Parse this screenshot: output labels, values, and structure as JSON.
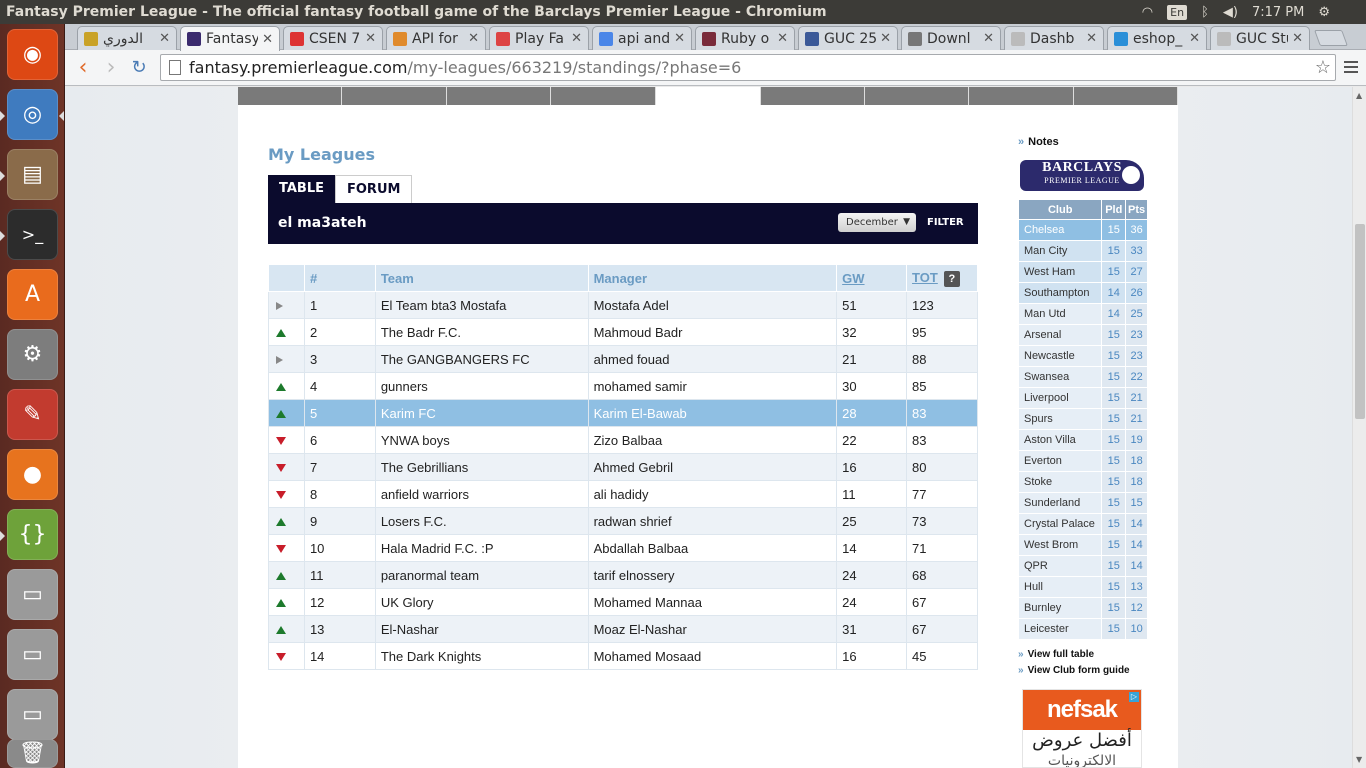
{
  "system": {
    "window_title": "Fantasy Premier League - The official fantasy football game of the Barclays Premier League - Chromium",
    "keyboard_layout": "En",
    "clock": "7:17 PM"
  },
  "launcher": {
    "items": [
      "ubuntu-dash",
      "chromium",
      "files",
      "terminal",
      "software-center",
      "system-settings",
      "document-viewer",
      "firefox",
      "brackets",
      "disk-1",
      "disk-2",
      "disk-3",
      "trash"
    ]
  },
  "browser": {
    "tabs": [
      {
        "label": "الدوري",
        "icon": "league-icon",
        "color": "#c9a227"
      },
      {
        "label": "Fantasy",
        "icon": "fpl-icon",
        "color": "#3b2b6e",
        "active": true
      },
      {
        "label": "CSEN 7",
        "icon": "csen-icon",
        "color": "#d33"
      },
      {
        "label": "API for",
        "icon": "api-icon",
        "color": "#e08a2b"
      },
      {
        "label": "Play Fa",
        "icon": "gmail-icon",
        "color": "#d44"
      },
      {
        "label": "api and",
        "icon": "google-icon",
        "color": "#4a86e8"
      },
      {
        "label": "Ruby o",
        "icon": "ruby-icon",
        "color": "#7a2b3a"
      },
      {
        "label": "GUC 25",
        "icon": "facebook-icon",
        "color": "#3b5998"
      },
      {
        "label": "Downl",
        "icon": "download-icon",
        "color": "#777"
      },
      {
        "label": "Dashb",
        "icon": "page-icon",
        "color": "#bbb"
      },
      {
        "label": "eshop_",
        "icon": "eshop-icon",
        "color": "#2a8fd8"
      },
      {
        "label": "GUC Stu",
        "icon": "page-icon",
        "color": "#bbb"
      }
    ],
    "url_host": "fantasy.premierleague.com",
    "url_path": "/my-leagues/663219/standings/?phase=6"
  },
  "page": {
    "heading": "My Leagues",
    "tabs": {
      "table": "TABLE",
      "forum": "FORUM"
    },
    "league_name": "el ma3ateh",
    "phase_select": "December",
    "filter_label": "FILTER",
    "columns": {
      "rank": "#",
      "team": "Team",
      "manager": "Manager",
      "gw": "GW",
      "tot": "TOT",
      "help": "?"
    },
    "rows": [
      {
        "move": "same",
        "rank": "1",
        "team": "El Team bta3 Mostafa",
        "manager": "Mostafa Adel",
        "gw": "51",
        "tot": "123"
      },
      {
        "move": "up",
        "rank": "2",
        "team": "The Badr F.C.",
        "manager": "Mahmoud Badr",
        "gw": "32",
        "tot": "95"
      },
      {
        "move": "same",
        "rank": "3",
        "team": "The GANGBANGERS FC",
        "manager": "ahmed fouad",
        "gw": "21",
        "tot": "88"
      },
      {
        "move": "up",
        "rank": "4",
        "team": "gunners",
        "manager": "mohamed samir",
        "gw": "30",
        "tot": "85"
      },
      {
        "move": "up",
        "rank": "5",
        "team": "Karim FC",
        "manager": "Karim El-Bawab",
        "gw": "28",
        "tot": "83",
        "highlight": true
      },
      {
        "move": "down",
        "rank": "6",
        "team": "YNWA boys",
        "manager": "Zizo Balbaa",
        "gw": "22",
        "tot": "83"
      },
      {
        "move": "down",
        "rank": "7",
        "team": "The Gebrillians",
        "manager": "Ahmed Gebril",
        "gw": "16",
        "tot": "80"
      },
      {
        "move": "down",
        "rank": "8",
        "team": "anfield warriors",
        "manager": "ali hadidy",
        "gw": "11",
        "tot": "77"
      },
      {
        "move": "up",
        "rank": "9",
        "team": "Losers F.C.",
        "manager": "radwan shrief",
        "gw": "25",
        "tot": "73"
      },
      {
        "move": "down",
        "rank": "10",
        "team": "Hala Madrid F.C. :P",
        "manager": "Abdallah Balbaa",
        "gw": "14",
        "tot": "71"
      },
      {
        "move": "up",
        "rank": "11",
        "team": "paranormal team",
        "manager": "tarif elnossery",
        "gw": "24",
        "tot": "68"
      },
      {
        "move": "up",
        "rank": "12",
        "team": "UK Glory",
        "manager": "Mohamed Mannaa",
        "gw": "24",
        "tot": "67"
      },
      {
        "move": "up",
        "rank": "13",
        "team": "El-Nashar",
        "manager": "Moaz El-Nashar",
        "gw": "31",
        "tot": "67"
      },
      {
        "move": "down",
        "rank": "14",
        "team": "The Dark Knights",
        "manager": "Mohamed Mosaad",
        "gw": "16",
        "tot": "45"
      }
    ]
  },
  "sidebar": {
    "notes": "Notes",
    "logo_line1": "BARCLAYS",
    "logo_line2": "PREMIER LEAGUE",
    "table_headers": {
      "club": "Club",
      "pld": "Pld",
      "pts": "Pts"
    },
    "clubs": [
      {
        "club": "Chelsea",
        "pld": "15",
        "pts": "36"
      },
      {
        "club": "Man City",
        "pld": "15",
        "pts": "33"
      },
      {
        "club": "West Ham",
        "pld": "15",
        "pts": "27"
      },
      {
        "club": "Southampton",
        "pld": "14",
        "pts": "26"
      },
      {
        "club": "Man Utd",
        "pld": "14",
        "pts": "25"
      },
      {
        "club": "Arsenal",
        "pld": "15",
        "pts": "23"
      },
      {
        "club": "Newcastle",
        "pld": "15",
        "pts": "23"
      },
      {
        "club": "Swansea",
        "pld": "15",
        "pts": "22"
      },
      {
        "club": "Liverpool",
        "pld": "15",
        "pts": "21"
      },
      {
        "club": "Spurs",
        "pld": "15",
        "pts": "21"
      },
      {
        "club": "Aston Villa",
        "pld": "15",
        "pts": "19"
      },
      {
        "club": "Everton",
        "pld": "15",
        "pts": "18"
      },
      {
        "club": "Stoke",
        "pld": "15",
        "pts": "18"
      },
      {
        "club": "Sunderland",
        "pld": "15",
        "pts": "15"
      },
      {
        "club": "Crystal Palace",
        "pld": "15",
        "pts": "14"
      },
      {
        "club": "West Brom",
        "pld": "15",
        "pts": "14"
      },
      {
        "club": "QPR",
        "pld": "15",
        "pts": "14"
      },
      {
        "club": "Hull",
        "pld": "15",
        "pts": "13"
      },
      {
        "club": "Burnley",
        "pld": "15",
        "pts": "12"
      },
      {
        "club": "Leicester",
        "pld": "15",
        "pts": "10"
      }
    ],
    "view_full_table": "View full table",
    "view_form_guide": "View Club form guide",
    "ad_brand": "nefsak",
    "ad_text": "أفضل عروض",
    "ad_text2": "الالكترونيات"
  }
}
